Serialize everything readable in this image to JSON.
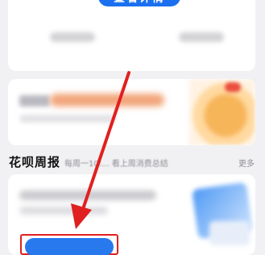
{
  "top_card": {
    "detail_button_label": "查看详情"
  },
  "weekly_report": {
    "title": "花呗周报",
    "subtitle": "每周一10:... 看上周消费总结",
    "more_label": "更多"
  },
  "annotation": {
    "arrow_color": "#e02020",
    "highlight_color": "#e02020"
  },
  "colors": {
    "accent": "#1b70f0",
    "background": "#f1f1f3"
  }
}
